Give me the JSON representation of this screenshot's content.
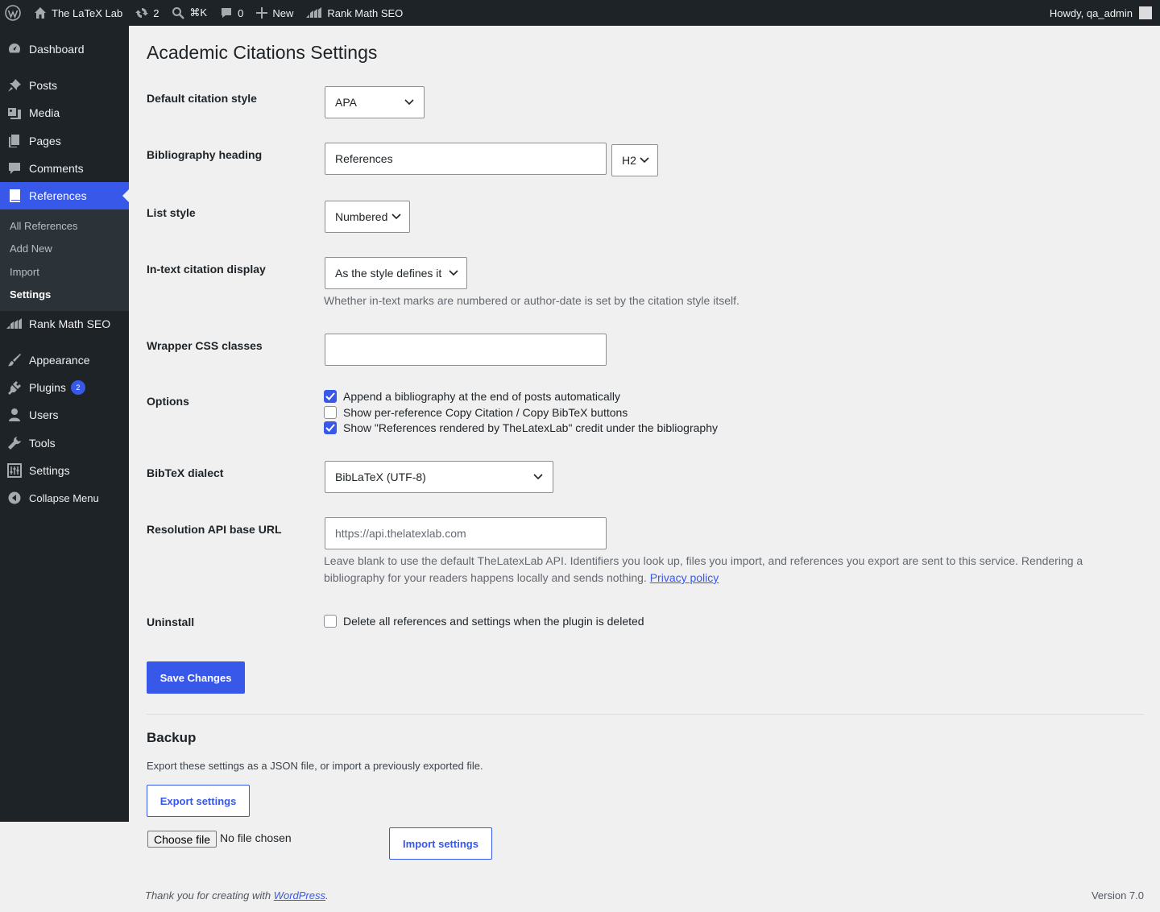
{
  "adminbar": {
    "site_name": "The LaTeX Lab",
    "updates_count": "2",
    "search_shortcut": "⌘K",
    "comments_count": "0",
    "new_label": "New",
    "plugin_label": "Rank Math SEO",
    "howdy": "Howdy, qa_admin"
  },
  "sidebar": {
    "items": [
      {
        "label": "Dashboard",
        "icon": "dashboard-icon"
      },
      {
        "label": "Posts",
        "icon": "pin-icon"
      },
      {
        "label": "Media",
        "icon": "media-icon"
      },
      {
        "label": "Pages",
        "icon": "pages-icon"
      },
      {
        "label": "Comments",
        "icon": "comment-icon"
      },
      {
        "label": "References",
        "icon": "book-icon"
      },
      {
        "label": "Rank Math SEO",
        "icon": "rankmath-icon"
      },
      {
        "label": "Appearance",
        "icon": "brush-icon"
      },
      {
        "label": "Plugins",
        "icon": "plug-icon",
        "badge": "2"
      },
      {
        "label": "Users",
        "icon": "user-icon"
      },
      {
        "label": "Tools",
        "icon": "wrench-icon"
      },
      {
        "label": "Settings",
        "icon": "settings-icon"
      },
      {
        "label": "Collapse Menu",
        "icon": "collapse-icon"
      }
    ],
    "submenu": [
      "All References",
      "Add New",
      "Import",
      "Settings"
    ]
  },
  "page": {
    "title": "Academic Citations Settings",
    "citation_style": {
      "label": "Default citation style",
      "value": "APA"
    },
    "bib_heading": {
      "label": "Bibliography heading",
      "value": "References",
      "level": "H2"
    },
    "list_style": {
      "label": "List style",
      "value": "Numbered"
    },
    "intext": {
      "label": "In-text citation display",
      "value": "As the style defines it",
      "desc": "Whether in-text marks are numbered or author-date is set by the citation style itself."
    },
    "wrapper": {
      "label": "Wrapper CSS classes",
      "value": ""
    },
    "options": {
      "label": "Options",
      "items": [
        {
          "label": "Append a bibliography at the end of posts automatically",
          "checked": true
        },
        {
          "label": "Show per-reference Copy Citation / Copy BibTeX buttons",
          "checked": false
        },
        {
          "label": "Show \"References rendered by TheLatexLab\" credit under the bibliography",
          "checked": true
        }
      ]
    },
    "bibtex": {
      "label": "BibTeX dialect",
      "value": "BibLaTeX (UTF-8)"
    },
    "api": {
      "label": "Resolution API base URL",
      "placeholder": "https://api.thelatexlab.com",
      "desc_line1": "Leave blank to use the default TheLatexLab API. Identifiers you look up, files you import, and references you export are sent to this service. Rendering a",
      "desc_line2": "bibliography for your readers happens locally and sends nothing.",
      "privacy_link": "Privacy policy"
    },
    "uninstall": {
      "label": "Uninstall",
      "checkbox_label": "Delete all references and settings when the plugin is deleted",
      "checked": false
    },
    "save_button": "Save Changes",
    "backup": {
      "title": "Backup",
      "desc": "Export these settings as a JSON file, or import a previously exported file.",
      "export_button": "Export settings",
      "choose_file": "Choose file",
      "no_file": "No file chosen",
      "import_button": "Import settings"
    }
  },
  "footer": {
    "thanks_prefix": "Thank you for creating with",
    "wordpress_link": "WordPress",
    "version": "Version 7.0"
  },
  "colors": {
    "accent": "#3858e9",
    "sidebar_bg": "#1d2327",
    "page_bg": "#f0f0f1"
  }
}
